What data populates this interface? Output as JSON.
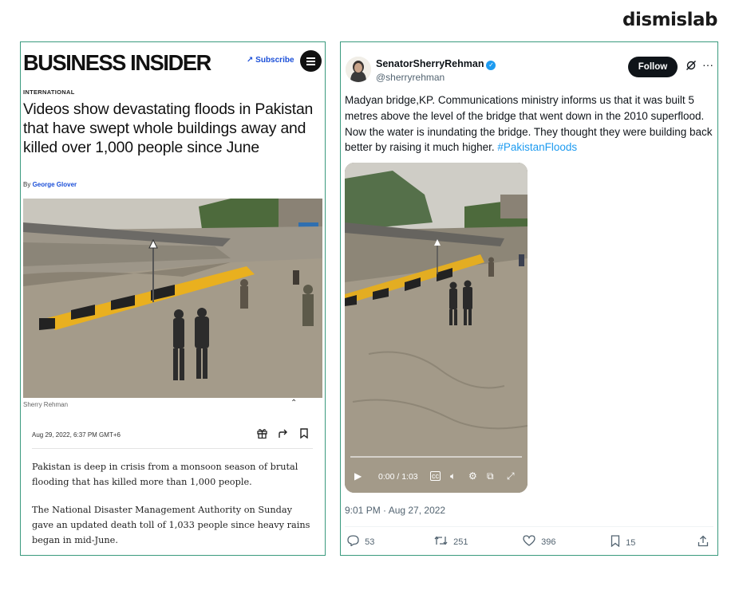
{
  "brand": {
    "logo_text": "dismislab"
  },
  "business_insider": {
    "logo": "BUSINESS INSIDER",
    "subscribe_label": "Subscribe",
    "menu_icon": "hamburger-menu-icon",
    "section": "INTERNATIONAL",
    "headline": "Videos show devastating floods in Pakistan that have swept whole buildings away and killed over 1,000 people since June",
    "byline_prefix": "By",
    "author": "George Glover",
    "image_caption": "Sherry Rehman",
    "date": "Aug 29, 2022, 6:37 PM GMT+6",
    "actions": [
      "gift-icon",
      "share-icon",
      "bookmark-icon"
    ],
    "paragraphs": [
      "Pakistan is deep in crisis from a monsoon season of brutal flooding that has killed more than 1,000 people.",
      "The National Disaster Management Authority on Sunday gave an updated death toll of 1,033 people since heavy rains began in mid-June."
    ]
  },
  "tweet": {
    "display_name": "SenatorSherryRehman",
    "handle": "@sherryrehman",
    "verified": true,
    "follow_label": "Follow",
    "text": "Madyan bridge,KP. Communications ministry informs us that it was built 5 metres above the level of the bridge that went down in the 2010 superflood. Now the water is inundating the bridge. They thought they were building back better by raising it much higher.",
    "hashtag": "#PakistanFloods",
    "video_time": "0:00 / 1:03",
    "timestamp": "9:01 PM · Aug 27, 2022",
    "stats": {
      "replies": "53",
      "retweets": "251",
      "likes": "396",
      "bookmarks": "15"
    },
    "colors": {
      "link": "#1d9bf0",
      "verified": "#1d9bf0",
      "muted": "#536471"
    }
  }
}
